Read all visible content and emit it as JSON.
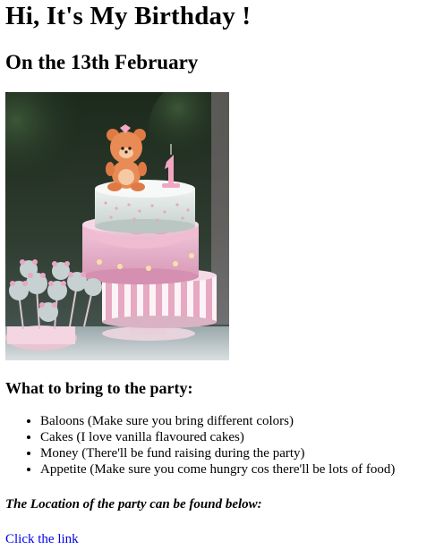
{
  "heading": "Hi, It's My Birthday !",
  "subheading": "On the 13th February",
  "image": {
    "subject": "birthday-cake"
  },
  "bring": {
    "title": "What to bring to the party:",
    "items": [
      "Baloons (Make sure you bring different colors)",
      "Cakes (I love vanilla flavoured cakes)",
      "Money (There'll be fund raising during the party)",
      "Appetite (Make sure you come hungry cos there'll be lots of food)"
    ]
  },
  "location_text": "The Location of the party can be found below:",
  "link_text": "Click the link",
  "colors": {
    "link": "#0000ee"
  }
}
